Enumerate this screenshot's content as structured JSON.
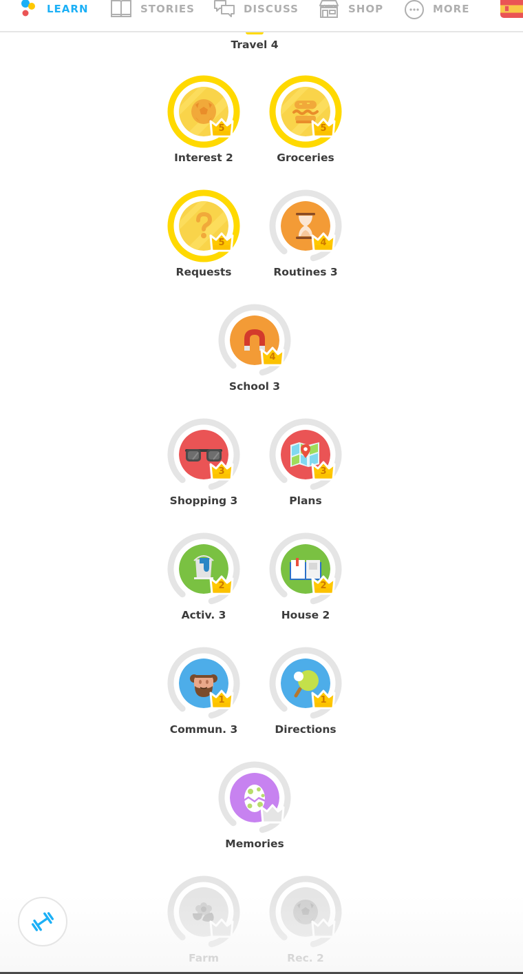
{
  "nav": {
    "items": [
      {
        "label": "LEARN",
        "icon": "duo-dots-icon",
        "active": true
      },
      {
        "label": "STORIES",
        "icon": "book-icon",
        "active": false
      },
      {
        "label": "DISCUSS",
        "icon": "chat-bubbles-icon",
        "active": false
      },
      {
        "label": "SHOP",
        "icon": "shop-icon",
        "active": false
      },
      {
        "label": "MORE",
        "icon": "more-dots-icon",
        "active": false
      }
    ],
    "language_flag": "spain-flag-icon",
    "accent_color": "#1cb0f6"
  },
  "previous_skill": {
    "label": "Travel 4"
  },
  "skills": [
    {
      "label": "Interest 2",
      "crown_level": "5",
      "status": "gold",
      "icon": "soccer-ball-icon"
    },
    {
      "label": "Groceries",
      "crown_level": "5",
      "status": "gold",
      "icon": "burger-icon"
    },
    {
      "label": "Requests",
      "crown_level": "5",
      "status": "gold",
      "icon": "question-mark-icon"
    },
    {
      "label": "Routines 3",
      "crown_level": "4",
      "status": "orange",
      "icon": "hourglass-icon",
      "progress": 0.85
    },
    {
      "label": "School 3",
      "crown_level": "4",
      "status": "orange",
      "icon": "magnet-icon",
      "progress": 0.85
    },
    {
      "label": "Shopping 3",
      "crown_level": "3",
      "status": "red",
      "icon": "sunglasses-icon",
      "progress": 0.85
    },
    {
      "label": "Plans",
      "crown_level": "3",
      "status": "red",
      "icon": "map-icon",
      "progress": 0.85
    },
    {
      "label": "Activ. 3",
      "crown_level": "2",
      "status": "green",
      "icon": "paint-bucket-icon",
      "progress": 0.85
    },
    {
      "label": "House 2",
      "crown_level": "2",
      "status": "green",
      "icon": "open-book-icon",
      "progress": 0.85
    },
    {
      "label": "Commun. 3",
      "crown_level": "1",
      "status": "blue",
      "icon": "bearded-man-icon",
      "progress": 0.85
    },
    {
      "label": "Directions",
      "crown_level": "1",
      "status": "blue",
      "icon": "ping-pong-paddle-icon",
      "progress": 0.85
    },
    {
      "label": "Memories",
      "crown_level": "",
      "status": "purple",
      "icon": "egg-icon",
      "progress": 0.85
    },
    {
      "label": "Farm",
      "crown_level": "",
      "status": "locked",
      "icon": "flower-icon",
      "progress": 0.85
    },
    {
      "label": "Rec. 2",
      "crown_level": "",
      "status": "locked",
      "icon": "soccer-ball-icon",
      "progress": 0.85
    }
  ],
  "colors": {
    "gold": "#ffd900",
    "orange": "#ff9600",
    "red": "#ea5455",
    "green": "#78c800",
    "blue": "#1cb0f6",
    "purple": "#ce82ff",
    "locked": "#e5e5e5",
    "crown": "#ffc800",
    "text": "#3c3c3c",
    "muted": "#afafaf"
  },
  "practice_button": {
    "icon": "dumbbell-icon"
  }
}
